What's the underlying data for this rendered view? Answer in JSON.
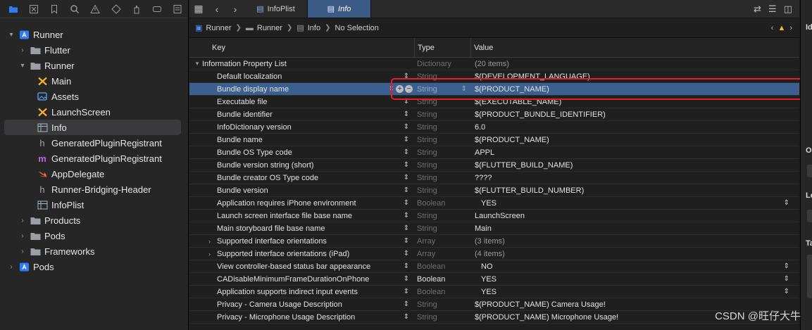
{
  "navigator": {
    "items": [
      {
        "label": "Runner",
        "icon": "project-icon",
        "disc": "▾",
        "level": 0
      },
      {
        "label": "Flutter",
        "icon": "folder-icon",
        "disc": "›",
        "level": 1
      },
      {
        "label": "Runner",
        "icon": "folder-icon",
        "disc": "▾",
        "level": 1
      },
      {
        "label": "Main",
        "icon": "storyboard-icon",
        "disc": "",
        "level": 2
      },
      {
        "label": "Assets",
        "icon": "assets-icon",
        "disc": "",
        "level": 2
      },
      {
        "label": "LaunchScreen",
        "icon": "storyboard-icon",
        "disc": "",
        "level": 2
      },
      {
        "label": "Info",
        "icon": "plist-icon",
        "disc": "",
        "level": 2,
        "selected": true
      },
      {
        "label": "GeneratedPluginRegistrant",
        "icon": "header-icon",
        "disc": "",
        "level": 2
      },
      {
        "label": "GeneratedPluginRegistrant",
        "icon": "objc-source-icon",
        "disc": "",
        "level": 2
      },
      {
        "label": "AppDelegate",
        "icon": "swift-icon",
        "disc": "",
        "level": 2
      },
      {
        "label": "Runner-Bridging-Header",
        "icon": "header-icon",
        "disc": "",
        "level": 2
      },
      {
        "label": "InfoPlist",
        "icon": "plist-icon",
        "disc": "",
        "level": 2
      },
      {
        "label": "Products",
        "icon": "folder-icon",
        "disc": "›",
        "level": 1
      },
      {
        "label": "Pods",
        "icon": "folder-icon",
        "disc": "›",
        "level": 1
      },
      {
        "label": "Frameworks",
        "icon": "folder-icon",
        "disc": "›",
        "level": 1
      },
      {
        "label": "Pods",
        "icon": "project-icon",
        "disc": "›",
        "level": 0
      }
    ]
  },
  "tabs": [
    {
      "label": "InfoPlist",
      "active": false
    },
    {
      "label": "Info",
      "active": true
    }
  ],
  "breadcrumb": [
    "Runner",
    "Runner",
    "Info",
    "No Selection"
  ],
  "plist": {
    "headers": {
      "key": "Key",
      "type": "Type",
      "value": "Value"
    },
    "root": {
      "key": "Information Property List",
      "type": "Dictionary",
      "value": "(20 items)"
    },
    "rows": [
      {
        "key": "Default localization",
        "type": "String",
        "value": "$(DEVELOPMENT_LANGUAGE)"
      },
      {
        "key": "Bundle display name",
        "type": "String",
        "value": "$(PRODUCT_NAME)",
        "selected": true
      },
      {
        "key": "Executable file",
        "type": "String",
        "value": "$(EXECUTABLE_NAME)"
      },
      {
        "key": "Bundle identifier",
        "type": "String",
        "value": "$(PRODUCT_BUNDLE_IDENTIFIER)"
      },
      {
        "key": "InfoDictionary version",
        "type": "String",
        "value": "6.0"
      },
      {
        "key": "Bundle name",
        "type": "String",
        "value": "$(PRODUCT_NAME)"
      },
      {
        "key": "Bundle OS Type code",
        "type": "String",
        "value": "APPL"
      },
      {
        "key": "Bundle version string (short)",
        "type": "String",
        "value": "$(FLUTTER_BUILD_NAME)"
      },
      {
        "key": "Bundle creator OS Type code",
        "type": "String",
        "value": "????"
      },
      {
        "key": "Bundle version",
        "type": "String",
        "value": "$(FLUTTER_BUILD_NUMBER)"
      },
      {
        "key": "Application requires iPhone environment",
        "type": "Boolean",
        "value": "YES",
        "popup": true
      },
      {
        "key": "Launch screen interface file base name",
        "type": "String",
        "value": "LaunchScreen"
      },
      {
        "key": "Main storyboard file base name",
        "type": "String",
        "value": "Main"
      },
      {
        "key": "Supported interface orientations",
        "type": "Array",
        "value": "(3 items)",
        "expandable": true
      },
      {
        "key": "Supported interface orientations (iPad)",
        "type": "Array",
        "value": "(4 items)",
        "expandable": true
      },
      {
        "key": "View controller-based status bar appearance",
        "type": "Boolean",
        "value": "NO",
        "popup": true
      },
      {
        "key": "CADisableMinimumFrameDurationOnPhone",
        "type": "Boolean",
        "value": "YES",
        "popup": true,
        "typeBright": true
      },
      {
        "key": "Application supports indirect input events",
        "type": "Boolean",
        "value": "YES",
        "popup": true
      },
      {
        "key": "Privacy - Camera Usage Description",
        "type": "String",
        "value": "$(PRODUCT_NAME) Camera Usage!"
      },
      {
        "key": "Privacy - Microphone Usage Description",
        "type": "String",
        "value": "$(PRODUCT_NAME) Microphone Usage!"
      }
    ]
  },
  "inspector": {
    "labels": [
      "Id",
      "O",
      "Lo",
      "Ta"
    ]
  },
  "watermark": "CSDN @旺仔大牛",
  "colors": {
    "selection": "#3b5f8e",
    "highlight": "#e31e24",
    "tab_active": "#3b5b86"
  }
}
